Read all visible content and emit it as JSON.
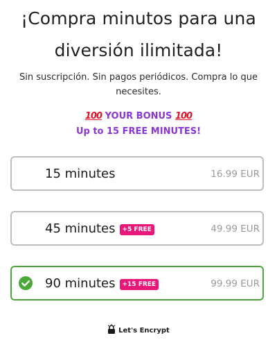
{
  "header": {
    "headline_line1": "¡Compra minutos para una",
    "headline_line2": "diversión ilimitada!",
    "subtext_line1": "Sin suscripción. Sin pagos periódicos. Compra lo que",
    "subtext_line2": "necesites."
  },
  "bonus": {
    "emoji_left": "100",
    "title": "YOUR BONUS",
    "emoji_right": "100",
    "subtitle": "Up to 15 FREE MINUTES!"
  },
  "plans": [
    {
      "name": "15 minutes",
      "badge": "",
      "price": "16.99 EUR",
      "selected": false
    },
    {
      "name": "45 minutes",
      "badge": "+5 FREE",
      "price": "49.99 EUR",
      "selected": false
    },
    {
      "name": "90 minutes",
      "badge": "+15 FREE",
      "price": "99.99 EUR",
      "selected": true
    }
  ],
  "footer": {
    "security_label": "Let's Encrypt",
    "security_icon": "lets-encrypt-icon"
  },
  "colors": {
    "accent_purple": "#8a36d6",
    "badge_pink": "#e8177a",
    "selected_green": "#4aa838",
    "emoji_red": "#e0152a"
  }
}
